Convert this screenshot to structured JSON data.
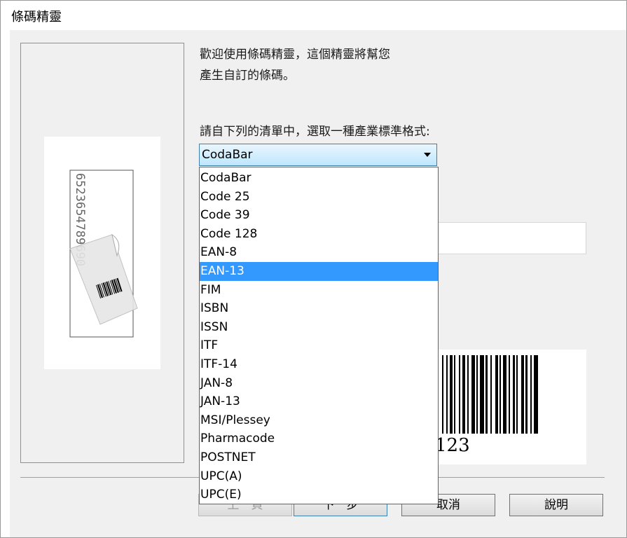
{
  "window": {
    "title": "條碼精靈"
  },
  "intro": {
    "text_line1": "歡迎使用條碼精靈，這個精靈將幫您",
    "text_line2": "產生自訂的條碼。"
  },
  "format_select": {
    "label": "請自下列的清單中，選取一種產業標準格式:",
    "value": "CodaBar",
    "options": [
      {
        "label": "CodaBar",
        "selected": false
      },
      {
        "label": "Code 25",
        "selected": false
      },
      {
        "label": "Code 39",
        "selected": false
      },
      {
        "label": "Code 128",
        "selected": false
      },
      {
        "label": "EAN-8",
        "selected": false
      },
      {
        "label": "EAN-13",
        "selected": true
      },
      {
        "label": "FIM",
        "selected": false
      },
      {
        "label": "ISBN",
        "selected": false
      },
      {
        "label": "ISSN",
        "selected": false
      },
      {
        "label": "ITF",
        "selected": false
      },
      {
        "label": "ITF-14",
        "selected": false
      },
      {
        "label": "JAN-8",
        "selected": false
      },
      {
        "label": "JAN-13",
        "selected": false
      },
      {
        "label": "MSI/Plessey",
        "selected": false
      },
      {
        "label": "Pharmacode",
        "selected": false
      },
      {
        "label": "POSTNET",
        "selected": false
      },
      {
        "label": "UPC(A)",
        "selected": false
      },
      {
        "label": "UPC(E)",
        "selected": false
      }
    ]
  },
  "illustration": {
    "digits": "6523654789690"
  },
  "barcode_preview": {
    "digits": "123"
  },
  "buttons": {
    "back": "上一頁",
    "next": "下一步",
    "cancel": "取消",
    "help": "說明"
  },
  "colors": {
    "selection": "#3399ff",
    "combo_border": "#3c7fb1"
  }
}
